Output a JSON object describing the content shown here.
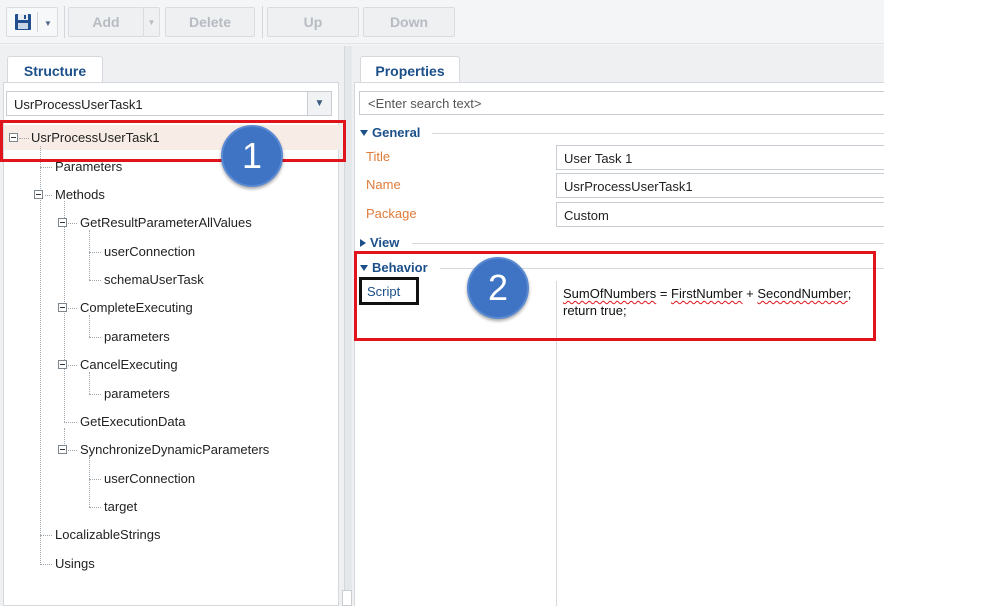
{
  "toolbar": {
    "save_icon": "floppy-disk-icon",
    "add_label": "Add",
    "delete_label": "Delete",
    "up_label": "Up",
    "down_label": "Down"
  },
  "left": {
    "tab_label": "Structure",
    "combo_value": "UsrProcessUserTask1",
    "tree": {
      "root": "UsrProcessUserTask1",
      "parameters": "Parameters",
      "methods": "Methods",
      "m1": "GetResultParameterAllValues",
      "m1_c1": "userConnection",
      "m1_c2": "schemaUserTask",
      "m2": "CompleteExecuting",
      "m2_c1": "parameters",
      "m3": "CancelExecuting",
      "m3_c1": "parameters",
      "m4": "GetExecutionData",
      "m5": "SynchronizeDynamicParameters",
      "m5_c1": "userConnection",
      "m5_c2": "target",
      "localizable": "LocalizableStrings",
      "usings": "Usings"
    }
  },
  "right": {
    "tab_label": "Properties",
    "search_placeholder": "<Enter search text>",
    "groups": {
      "general": "General",
      "view": "View",
      "behavior": "Behavior"
    },
    "props": {
      "title_label": "Title",
      "title_value": "User Task 1",
      "name_label": "Name",
      "name_value": "UsrProcessUserTask1",
      "package_label": "Package",
      "package_value": "Custom",
      "script_label": "Script"
    },
    "script": {
      "w1": "SumOfNumbers",
      "op1": " = ",
      "w2": "FirstNumber",
      "op2": " + ",
      "w3": "SecondNumber",
      "end1": ";",
      "line2": "return true;"
    }
  },
  "annotations": {
    "badge1": "1",
    "badge2": "2",
    "highlight_color": "#e0141b",
    "badge_color": "#3f74c4"
  }
}
